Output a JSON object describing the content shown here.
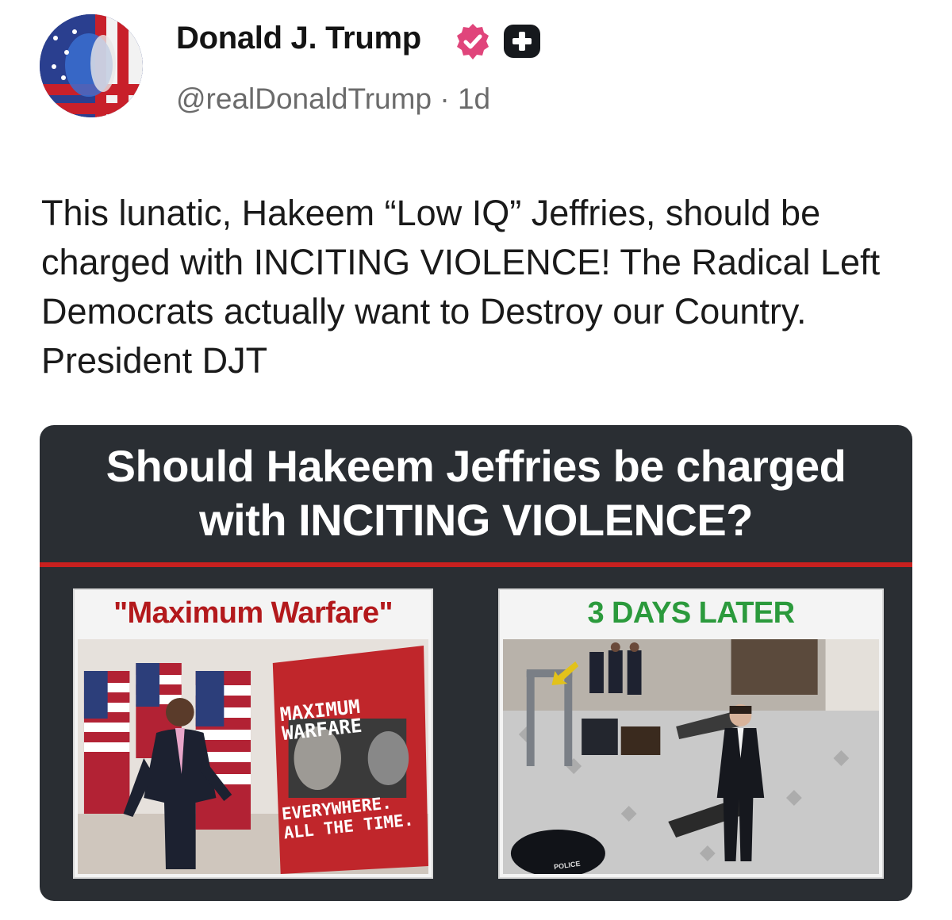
{
  "author": {
    "display_name": "Donald J. Trump",
    "handle": "@realDonaldTrump",
    "separator": "·",
    "time_ago": "1d",
    "verified_color": "#e0457b"
  },
  "post": {
    "text": "This lunatic, Hakeem “Low IQ” Jeffries, should be charged with INCITING VIOLENCE! The Radical Left Democrats actually want to Destroy our Country. President DJT"
  },
  "image_card": {
    "title_line1": "Should Hakeem Jeffries be charged",
    "title_line2": "with INCITING VIOLENCE?",
    "left_panel": {
      "caption": "\"Maximum Warfare\"",
      "sign_line1": "MAXIMUM",
      "sign_line2": "WARFARE",
      "sign_line3": "EVERYWHERE.",
      "sign_line4": "ALL THE TIME."
    },
    "right_panel": {
      "caption": "3 DAYS LATER",
      "badge_text": "POLICE"
    },
    "colors": {
      "background": "#2a2e33",
      "divider": "#c8201f",
      "left_caption": "#b3191c",
      "right_caption": "#2b9a3c"
    }
  }
}
